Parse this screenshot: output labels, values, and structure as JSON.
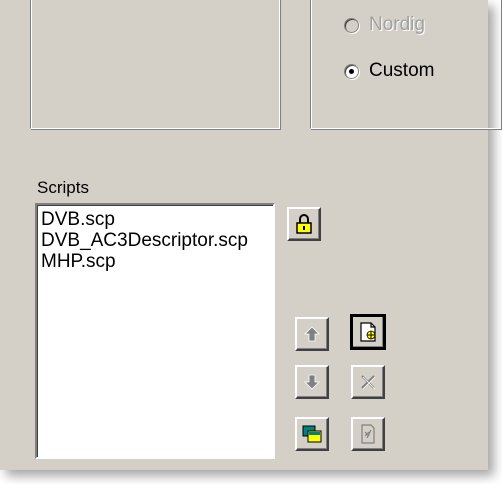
{
  "radios": {
    "nordig_label": "Nordig",
    "custom_label": "Custom"
  },
  "scripts": {
    "label": "Scripts",
    "items": [
      "DVB.scp",
      "DVB_AC3Descriptor.scp",
      "MHP.scp"
    ]
  },
  "icons": {
    "lock": "lock-icon",
    "move_up": "arrow-up-icon",
    "move_down": "arrow-down-icon",
    "add": "add-file-icon",
    "delete": "delete-x-icon",
    "copy": "copy-icon",
    "edit": "edit-file-icon"
  },
  "colors": {
    "dialog_bg": "#d4d0c8",
    "lock_yellow": "#ffff00"
  }
}
